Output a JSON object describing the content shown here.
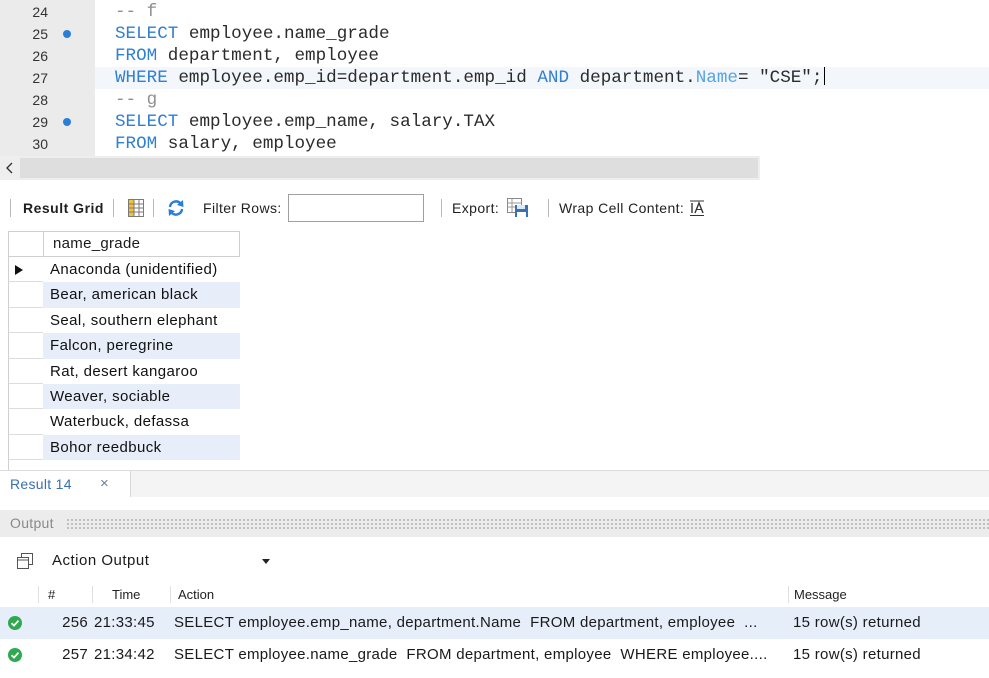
{
  "editor": {
    "lines": [
      {
        "num": "24",
        "parts": [
          "-- f"
        ]
      },
      {
        "num": "25",
        "parts": [
          "SELECT",
          " employee.name_grade"
        ]
      },
      {
        "num": "26",
        "parts": [
          "FROM",
          " department, employee"
        ]
      },
      {
        "num": "27",
        "parts": [
          "WHERE",
          " employee.emp_id=department.emp_id ",
          "AND",
          " department.",
          "Name",
          "= ",
          "\"CSE\"",
          ";"
        ]
      },
      {
        "num": "28",
        "parts": [
          "-- g"
        ]
      },
      {
        "num": "29",
        "parts": [
          "SELECT",
          " employee.emp_name, salary.TAX"
        ]
      },
      {
        "num": "30",
        "parts": [
          "FROM",
          " salary, employee"
        ]
      }
    ]
  },
  "result_toolbar": {
    "result_grid_label": "Result Grid",
    "filter_label": "Filter Rows:",
    "export_label": "Export:",
    "wrap_label": "Wrap Cell Content:"
  },
  "result_grid": {
    "columns": [
      "name_grade"
    ],
    "rows": [
      "Anaconda (unidentified)",
      "Bear, american black",
      "Seal, southern elephant",
      "Falcon, peregrine",
      "Rat, desert kangaroo",
      "Weaver, sociable",
      "Waterbuck, defassa",
      "Bohor reedbuck"
    ],
    "selected_row": 0
  },
  "result_tabs": [
    {
      "label": "Result 14",
      "close": "×"
    }
  ],
  "output": {
    "title": "Output",
    "view": "Action Output",
    "columns": {
      "num": "#",
      "time": "Time",
      "action": "Action",
      "message": "Message"
    },
    "rows": [
      {
        "status_icon": "check-circle-icon",
        "num": "256",
        "time": "21:33:45",
        "action": "SELECT employee.emp_name, department.Name  FROM department, employee  ...",
        "message": "15 row(s) returned"
      },
      {
        "status_icon": "check-circle-icon",
        "num": "257",
        "time": "21:34:42",
        "action": "SELECT employee.name_grade  FROM department, employee  WHERE employee....",
        "message": "15 row(s) returned"
      }
    ]
  },
  "icons": {
    "statement_marker": "statement-marker-icon",
    "scroll_left": "chevron-left-icon",
    "form_grid": "grid-icon",
    "refresh": "refresh-icon",
    "export": "export-icon",
    "wrap": "wrap-text-icon",
    "row_pointer": "row-pointer-icon",
    "action_output": "window-copy-icon",
    "dropdown": "chevron-down-icon",
    "success": "check-circle-icon"
  },
  "colors": {
    "keyword": "#2f7fd3",
    "comment": "#8f8f8f",
    "identifier": "#2b2b2b",
    "alt_row": "#e7edf9",
    "tab_text": "#3a6fb0",
    "success": "#2fa84f",
    "marker": "#2b7ed6"
  }
}
